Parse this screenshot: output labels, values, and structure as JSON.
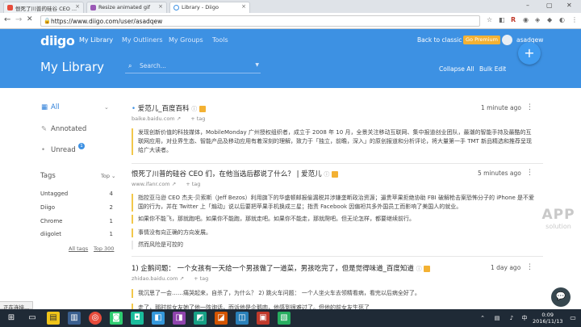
{
  "browser": {
    "tabs": [
      {
        "label": "恨死了川普的硅谷 CEO ..."
      },
      {
        "label": "Resize animated gif"
      },
      {
        "label": "Library - Diigo"
      }
    ],
    "url": "https://www.diigo.com/user/asadqew"
  },
  "app": {
    "logo": "diigo",
    "nav": [
      "My Library",
      "My Outliners",
      "My Groups",
      "Tools"
    ],
    "back_to_classic": "Back to classic",
    "premium": "Go Premium",
    "username": "asadqew",
    "page_title": "My Library",
    "search_placeholder": "Search...",
    "collapse_all": "Collapse All",
    "bulk_edit": "Bulk Edit",
    "fab": "+"
  },
  "sidebar": {
    "filters": [
      "All",
      "Annotated",
      "Unread"
    ],
    "unread_count": "1",
    "tags_heading": "Tags",
    "tags_sort": "Top",
    "tags": [
      {
        "name": "Untagged",
        "count": "4"
      },
      {
        "name": "Diigo",
        "count": "2"
      },
      {
        "name": "Chrome",
        "count": "1"
      },
      {
        "name": "diigolet",
        "count": "1"
      }
    ],
    "all_tags": "All tags",
    "top300": "Top 300"
  },
  "entries": [
    {
      "title": "爱范儿_百度百科",
      "time": "1 minute ago",
      "domain": "baike.baidu.com",
      "tag_add": "+ tag",
      "highlights": [
        "发现创新价值的科技媒体，MobileMonday 广州授权组织者，成立于 2008 年 10 月，全景关注移动互联网、集中报道创业团队，最潮的智能手持及最酷的互联网应用，对业界生态、智能产品及移动应用有着深刻的理解，致力于「独立，前瞻，深入」的原创报道和分析评论，将大量第一手 TMT 新品精选和推荐呈现给广大读者。"
      ]
    },
    {
      "title": "恨死了川普的硅谷 CEO 们，在他当选后都说了什么？ | 爱范儿",
      "time": "5 minutes ago",
      "domain": "www.ifanr.com",
      "tag_add": "+ tag",
      "highlights": [
        "指控亚马逊 CEO 杰夫·贝索斯（Jeff Bezos）利用旗下的华盛顿邮报偷漏税并涉嫌垄断政治资源；逼贵苹果拒绝协助 FBI 破解枪击案恐怖分子的 iPhone 是不爱国的行为，并在 Twitter 上「煽动」说以后要把苹果手机换成三星；指责 Facebook 因偏袒共多外国员工而影响了美国人的就业。",
        "如果你不能飞，那就跑吧。如果你不能跑，那就走吧。如果你不能走，那就爬吧。但无论怎样，都要继续前行。",
        "事情没有向正确的方向发展。",
        "然而风险是可控的"
      ]
    },
    {
      "title": "1) 企鹅问题： 一个女孩有一天给一个男孩做了一道菜，男孩吃完了，但是觉得味道_百度知道",
      "time": "1 day ago",
      "domain": "zhidao.baidu.com",
      "tag_add": "+ tag",
      "highlights": [
        "我沉思了一会……痛哭起来，自杀了，为什么？ 2) 跳火车问题： 一个人坐火车去领精看病，看完以后病全好了。",
        "走了，那时前女友她了他一阵询话，而诉他是企鹅肉，他感到很难过了。但他的前女友生死了"
      ]
    }
  ],
  "statusbar": "正在连接...",
  "watermark": {
    "line1": "APP",
    "line2": "solution"
  },
  "taskbar": {
    "time": "0:09",
    "date": "2016/11/13"
  }
}
